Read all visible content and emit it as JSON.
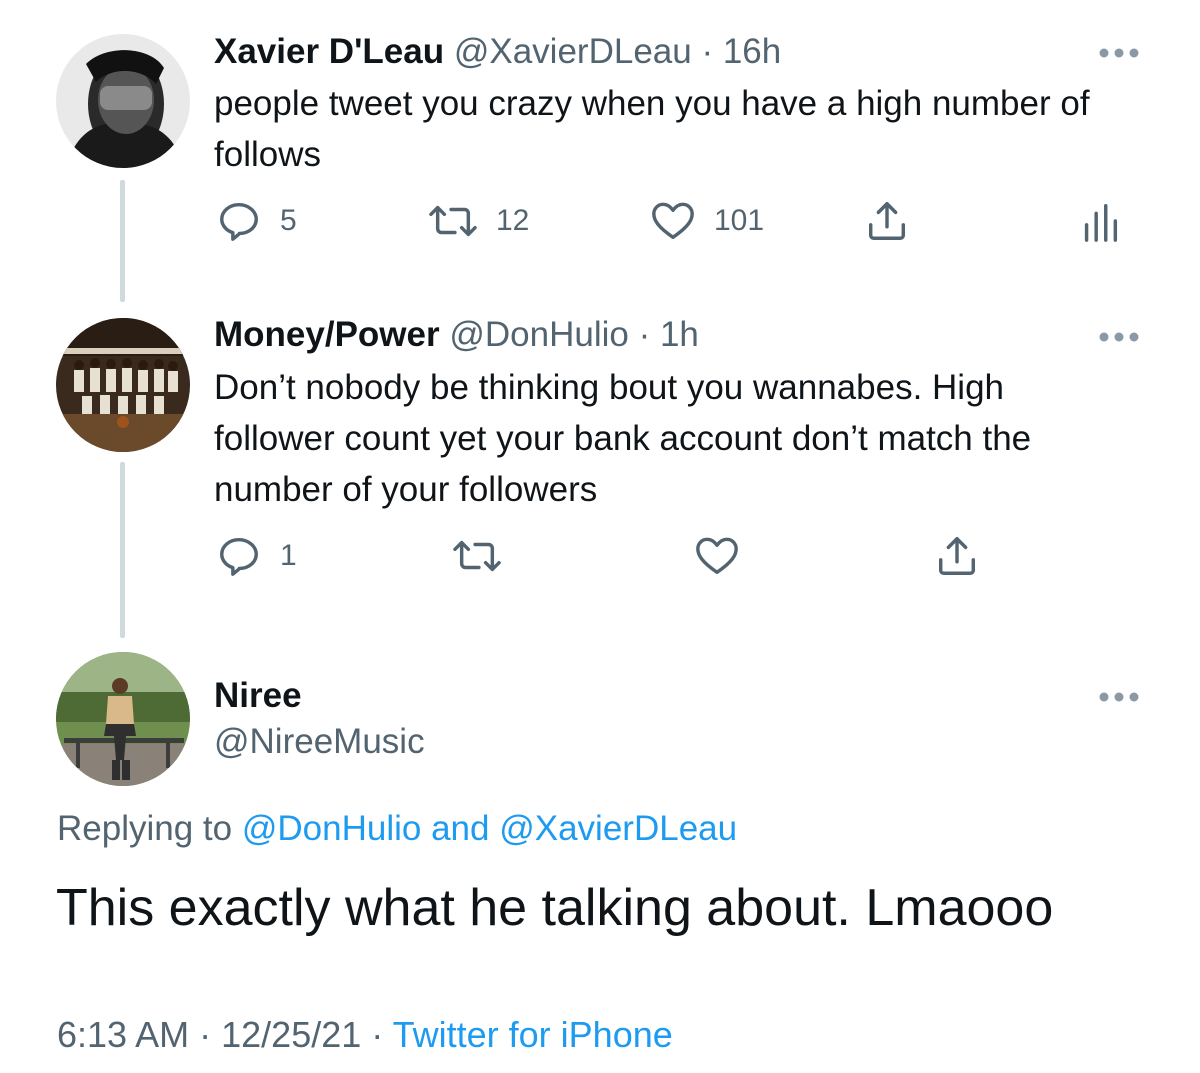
{
  "tweets": [
    {
      "name": "Xavier D'Leau",
      "handle": "@XavierDLeau",
      "time": "16h",
      "text": "people tweet you crazy when you have a high number of follows",
      "replies": "5",
      "retweets": "12",
      "likes": "101"
    },
    {
      "name": "Money/Power",
      "handle": "@DonHulio",
      "time": "1h",
      "text": "Don’t nobody be thinking bout you wannabes. High follower count yet your bank account don’t match the number of your followers",
      "replies": "1"
    }
  ],
  "main_tweet": {
    "name": "Niree",
    "handle": "@NireeMusic",
    "replying_prefix": "Replying to",
    "replying_to_1": "@DonHulio",
    "replying_and": "and",
    "replying_to_2": "@XavierDLeau",
    "text": "This exactly what he talking about. Lmaooo",
    "time": "6:13 AM",
    "date": "12/25/21",
    "source": "Twitter for iPhone"
  },
  "separators": {
    "dot": "·"
  },
  "icons": {
    "more": "more-options-icon",
    "reply": "reply-icon",
    "retweet": "retweet-icon",
    "like": "heart-icon",
    "share": "share-icon",
    "analytics": "analytics-icon"
  },
  "colors": {
    "text": "#0f1419",
    "secondary": "#536471",
    "link": "#1d9bf0",
    "thread_line": "#cfd9de"
  }
}
